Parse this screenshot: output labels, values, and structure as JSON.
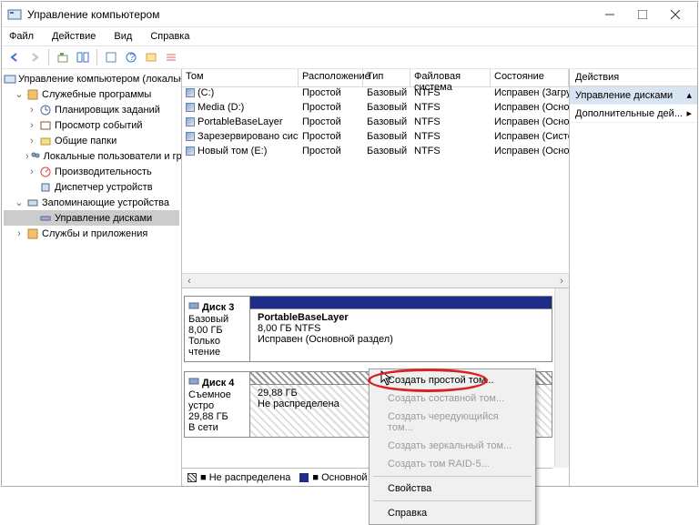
{
  "title": "Управление компьютером",
  "menus": [
    "Файл",
    "Действие",
    "Вид",
    "Справка"
  ],
  "tree": {
    "root": "Управление компьютером (локальным)",
    "sys": "Служебные программы",
    "sys_items": [
      "Планировщик заданий",
      "Просмотр событий",
      "Общие папки",
      "Локальные пользователи и группы",
      "Производительность",
      "Диспетчер устройств"
    ],
    "storage": "Запоминающие устройства",
    "disks": "Управление дисками",
    "services": "Службы и приложения"
  },
  "cols": [
    "Том",
    "Расположение",
    "Тип",
    "Файловая система",
    "Состояние"
  ],
  "vols": [
    {
      "n": "(C:)",
      "l": "Простой",
      "t": "Базовый",
      "f": "NTFS",
      "s": "Исправен (Загрузка, Ф"
    },
    {
      "n": "Media (D:)",
      "l": "Простой",
      "t": "Базовый",
      "f": "NTFS",
      "s": "Исправен (Основной р"
    },
    {
      "n": "PortableBaseLayer",
      "l": "Простой",
      "t": "Базовый",
      "f": "NTFS",
      "s": "Исправен (Основной р"
    },
    {
      "n": "Зарезервировано системой",
      "l": "Простой",
      "t": "Базовый",
      "f": "NTFS",
      "s": "Исправен (Система, А"
    },
    {
      "n": "Новый том (E:)",
      "l": "Простой",
      "t": "Базовый",
      "f": "NTFS",
      "s": "Исправен (Основной р"
    }
  ],
  "disk3": {
    "name": "Диск 3",
    "type": "Базовый",
    "size": "8,00 ГБ",
    "mode": "Только чтение",
    "vname": "PortableBaseLayer",
    "vsize": "8,00 ГБ NTFS",
    "vstat": "Исправен (Основной раздел)"
  },
  "disk4": {
    "name": "Диск 4",
    "type": "Съемное устро",
    "size": "29,88 ГБ",
    "mode": "В сети",
    "vsize": "29,88 ГБ",
    "vstat": "Не распределена"
  },
  "legend": {
    "unalloc": "Не распределена",
    "primary": "Основной раздел"
  },
  "actions": {
    "hdr": "Действия",
    "disks": "Управление дисками",
    "more": "Дополнительные дей..."
  },
  "ctx": [
    "Создать простой том...",
    "Создать составной том...",
    "Создать чередующийся том...",
    "Создать зеркальный том...",
    "Создать том RAID-5...",
    "Свойства",
    "Справка"
  ]
}
